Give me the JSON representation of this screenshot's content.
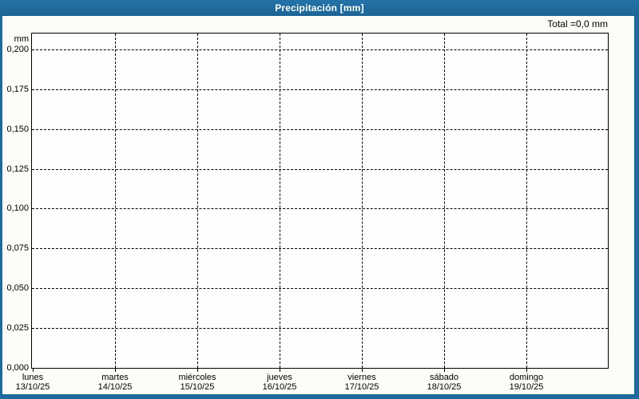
{
  "window": {
    "title": "Precipitación [mm]",
    "colors": {
      "titlebar": "#1e6a9e",
      "border": "#1e6a9e",
      "title_text": "#ffffff",
      "panel_bg": "#fcfdf7",
      "plot_bg": "#fefefc",
      "grid": "#000000",
      "label_text": "#000000"
    }
  },
  "summary": {
    "total_label": "Total =0,0 mm"
  },
  "chart_data": {
    "type": "bar",
    "title": "Precipitación [mm]",
    "ylabel": "mm",
    "xlabel": "",
    "ylim": [
      0,
      0.21
    ],
    "y_tick_step": 0.025,
    "grid": "dashed",
    "legend_position": "none",
    "y_tick_labels": [
      "0,200",
      "0,175",
      "0,150",
      "0,125",
      "0,100",
      "0,075",
      "0,050",
      "0,025",
      "0,000"
    ],
    "categories": [
      {
        "day": "lunes",
        "date": "13/10/25"
      },
      {
        "day": "martes",
        "date": "14/10/25"
      },
      {
        "day": "miércoles",
        "date": "15/10/25"
      },
      {
        "day": "jueves",
        "date": "16/10/25"
      },
      {
        "day": "viernes",
        "date": "17/10/25"
      },
      {
        "day": "sábado",
        "date": "18/10/25"
      },
      {
        "day": "domingo",
        "date": "19/10/25"
      }
    ],
    "values": [
      0,
      0,
      0,
      0,
      0,
      0,
      0
    ],
    "total": "0,0 mm"
  }
}
